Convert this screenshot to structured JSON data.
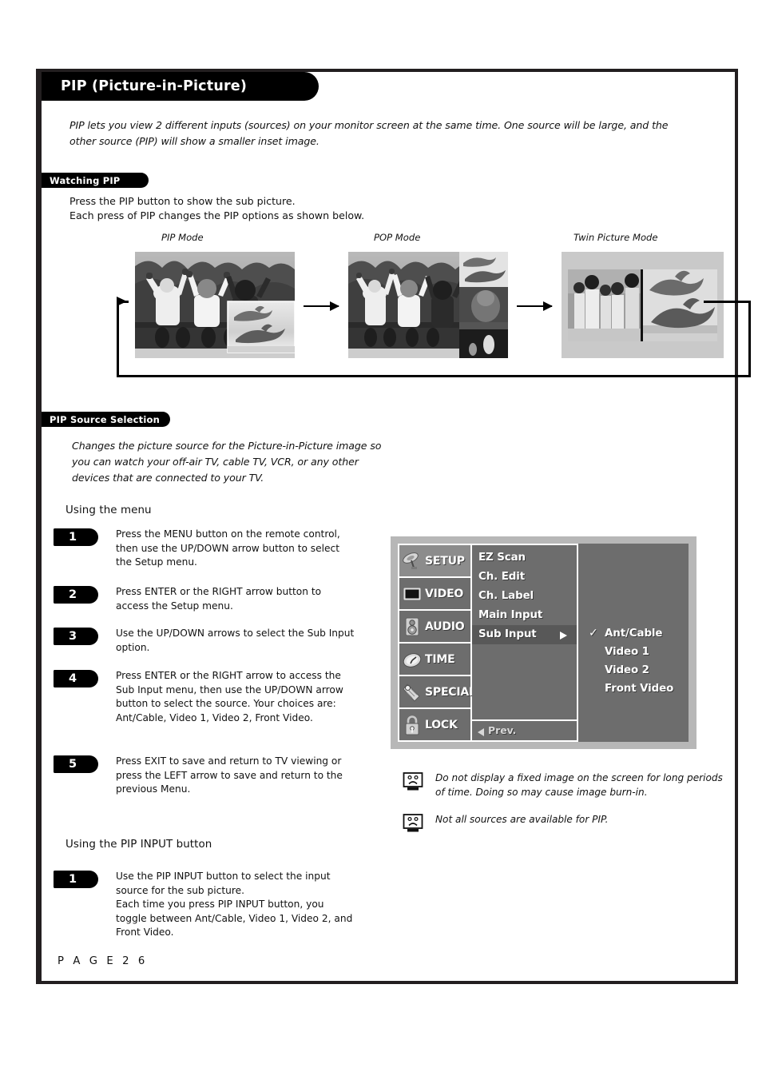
{
  "document": {
    "title": "PIP (Picture-in-Picture)",
    "intro": "PIP lets you view 2 different inputs (sources) on your monitor screen at the same time. One source will be large, and the other source (PIP) will show a smaller inset image.",
    "page_footer": "P A G E   2 6"
  },
  "watching_section": {
    "pill": "Watching PIP",
    "body": "Press the PIP button to show the sub picture.\nEach press of PIP changes the PIP options as shown below."
  },
  "modes": [
    {
      "label": "PIP Mode"
    },
    {
      "label": "POP Mode"
    },
    {
      "label": "Twin Picture Mode"
    }
  ],
  "source_section": {
    "pill": "PIP Source Selection",
    "body": "Changes the picture source for the Picture-in-Picture image so you can watch your off-air TV, cable TV, VCR, or any other devices that are connected to your TV.",
    "using_menu_heading": "Using the menu",
    "using_pip_heading": "Using the PIP INPUT button"
  },
  "menu_steps": [
    {
      "num": "1",
      "text": "Press the MENU button on the remote control, then use the UP/DOWN arrow button to select the Setup menu."
    },
    {
      "num": "2",
      "text": "Press ENTER or the RIGHT arrow button to access the Setup menu."
    },
    {
      "num": "3",
      "text": "Use the UP/DOWN arrows to select the Sub Input option."
    },
    {
      "num": "4",
      "text": "Press ENTER or the RIGHT arrow to access the Sub Input menu, then use the UP/DOWN arrow button to select the source. Your choices are: Ant/Cable, Video 1, Video 2, Front Video."
    },
    {
      "num": "5",
      "text": "Press EXIT to save and return to TV viewing or press the LEFT arrow to save and return to the previous Menu."
    }
  ],
  "pip_steps": [
    {
      "num": "1",
      "text": "Use the PIP INPUT button to select the input source for the sub picture.\nEach time you press PIP INPUT button, you toggle between Ant/Cable, Video 1, Video 2, and Front Video."
    }
  ],
  "osd": {
    "categories": [
      {
        "label": "SETUP",
        "icon": "satellite-dish-icon",
        "active": true
      },
      {
        "label": "VIDEO",
        "icon": "monitor-icon",
        "active": false
      },
      {
        "label": "AUDIO",
        "icon": "speaker-icon",
        "active": false
      },
      {
        "label": "TIME",
        "icon": "clock-icon",
        "active": false
      },
      {
        "label": "SPECIAL",
        "icon": "tag-icon",
        "active": false
      },
      {
        "label": "LOCK",
        "icon": "padlock-icon",
        "active": false
      }
    ],
    "items": [
      {
        "label": "EZ Scan",
        "selected": false,
        "has_submenu": false
      },
      {
        "label": "Ch. Edit",
        "selected": false,
        "has_submenu": false
      },
      {
        "label": "Ch. Label",
        "selected": false,
        "has_submenu": false
      },
      {
        "label": "Main Input",
        "selected": false,
        "has_submenu": false
      },
      {
        "label": "Sub Input",
        "selected": true,
        "has_submenu": true
      }
    ],
    "prev_label": "Prev.",
    "options": [
      {
        "label": "Ant/Cable",
        "checked": true
      },
      {
        "label": "Video 1",
        "checked": false
      },
      {
        "label": "Video 2",
        "checked": false
      },
      {
        "label": "Front Video",
        "checked": false
      }
    ],
    "colors": {
      "panel_bg": "#b7b7b7",
      "menu_bg": "#6d6d6d",
      "selected_bg": "#585858",
      "active_cat_bg": "#8c8c8c",
      "text": "#ffffff"
    }
  },
  "notes": [
    {
      "icon": "sad-tv-icon",
      "text": "Do not display a fixed image on the screen for long periods of  time. Doing so may cause image burn-in."
    },
    {
      "icon": "sad-tv-icon",
      "text": "Not all sources are available for PIP."
    }
  ]
}
